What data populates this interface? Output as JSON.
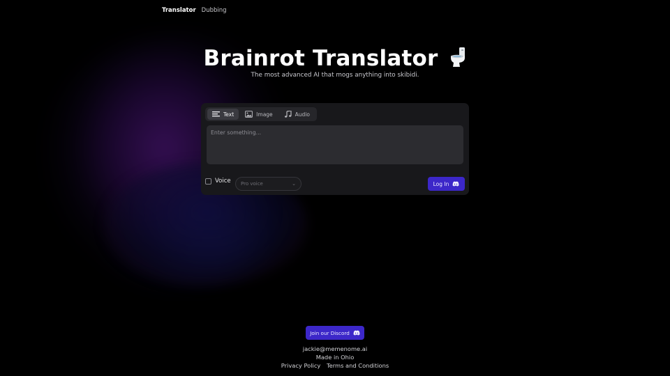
{
  "nav": {
    "items": [
      {
        "label": "Translator",
        "active": true
      },
      {
        "label": "Dubbing",
        "active": false
      }
    ]
  },
  "hero": {
    "title": "Brainrot Translator",
    "title_emoji_icon": "toilet-icon",
    "subtitle": "The most advanced AI that mogs anything into skibidi."
  },
  "translator": {
    "tabs": [
      {
        "label": "Text",
        "icon": "text-lines-icon",
        "active": true
      },
      {
        "label": "Image",
        "icon": "image-icon",
        "active": false
      },
      {
        "label": "Audio",
        "icon": "music-note-icon",
        "active": false
      }
    ],
    "input_placeholder": "Enter something...",
    "input_value": "",
    "voice_label": "Voice",
    "voice_checked": false,
    "voice_select_placeholder": "Pro voice",
    "login_label": "Log In",
    "accent_color": "#3c27c9"
  },
  "footer": {
    "discord_label": "Join our Discord",
    "email": "jackie@memenome.ai",
    "made_in": "Made in Ohio",
    "privacy": "Privacy Policy",
    "terms": "Terms and Conditions"
  }
}
